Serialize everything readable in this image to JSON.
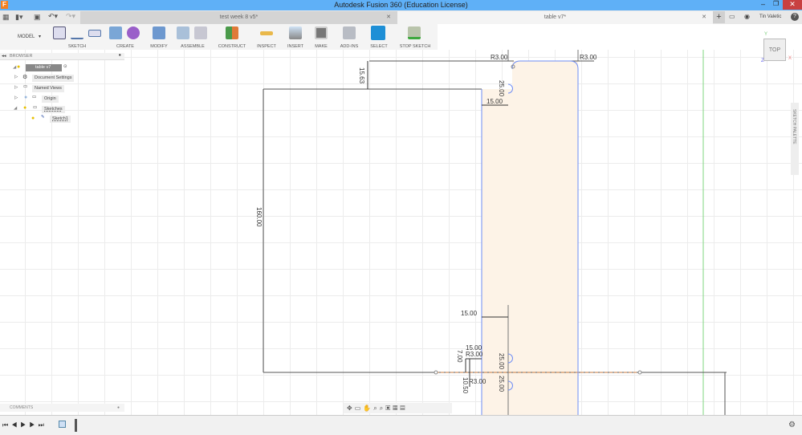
{
  "window": {
    "title": "Autodesk Fusion 360 (Education License)"
  },
  "tabs": [
    {
      "label": "test week 8 v5*",
      "active": false
    },
    {
      "label": "table v7*",
      "active": true
    }
  ],
  "user": {
    "name": "Tin Valetic"
  },
  "toolbar": {
    "workspace": "MODEL",
    "groups": [
      "SKETCH",
      "CREATE",
      "MODIFY",
      "ASSEMBLE",
      "CONSTRUCT",
      "INSPECT",
      "INSERT",
      "MAKE",
      "ADD-INS",
      "SELECT",
      "STOP SKETCH"
    ]
  },
  "browser": {
    "title": "BROWSER",
    "items": [
      {
        "label": "table v7"
      },
      {
        "label": "Document Settings"
      },
      {
        "label": "Named Views"
      },
      {
        "label": "Origin"
      },
      {
        "label": "Sketches"
      },
      {
        "label": "Sketch1"
      }
    ]
  },
  "comments": {
    "title": "COMMENTS"
  },
  "viewcube": {
    "face": "TOP",
    "x": "X",
    "y": "Y",
    "z": "Z"
  },
  "side_panel": {
    "label": "SKETCH PALETTE"
  },
  "dimensions": {
    "d_top_r1": "R3.00",
    "d_top_r2": "R3.00",
    "d_1563": "15.63",
    "d_2500_top": "25.00",
    "d_1500_top": "15.00",
    "d_160": "160.00",
    "d_1500_mid": "15.00",
    "d_1500_low": "15.00",
    "d_r3_low": "R3.00",
    "d_700": "7.00",
    "d_2500_low": "25.00",
    "d_1050": "10.50",
    "d_r3_bot": "R3.00",
    "d_2500_bot": "25.00"
  },
  "colors": {
    "title_bar": "#5fb0f7",
    "profile_fill": "#fdf3e7",
    "sketch_line": "#6e8df5",
    "y_axis": "#7fd47f",
    "x_axis": "#c8783c"
  }
}
